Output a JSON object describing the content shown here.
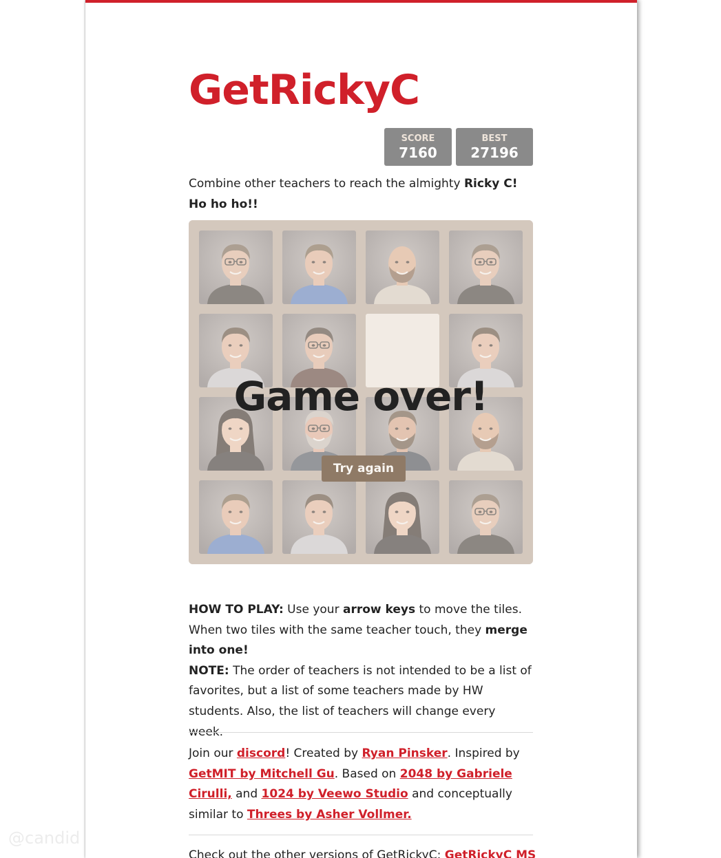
{
  "header": {
    "title": "GetRickyC",
    "score_label": "SCORE",
    "score_value": "7160",
    "best_label": "BEST",
    "best_value": "27196"
  },
  "intro": {
    "text_before": "Combine other teachers to reach the almighty ",
    "highlight": "Ricky C! Ho ho ho!!"
  },
  "board": {
    "rows": [
      [
        "teacher-glasses-man",
        "teacher-blue-shirt-man",
        "teacher-bald-beard-man",
        "teacher-glasses-man"
      ],
      [
        "teacher-plaid-shirt-man",
        "teacher-glasses-woman",
        "empty",
        "teacher-plaid-shirt-man"
      ],
      [
        "teacher-dark-hair-woman",
        "teacher-gray-hair-man",
        "teacher-beard-man",
        "teacher-bald-beard-man"
      ],
      [
        "teacher-blue-shirt-man",
        "teacher-plaid-shirt-man",
        "teacher-dark-hair-woman",
        "teacher-glasses-man"
      ]
    ],
    "game_over_text": "Game over!",
    "try_again_label": "Try again"
  },
  "howto": {
    "label": "HOW TO PLAY:",
    "text1": " Use your ",
    "bold1": "arrow keys",
    "text2": " to move the tiles. When two tiles with the same teacher touch, they ",
    "bold2": "merge into one!",
    "note_label": "NOTE:",
    "note_text": " The order of teachers is not intended to be a list of favorites, but a list of some teachers made by HW students. Also, the list of teachers will change every week."
  },
  "credits": {
    "t1": "Join our ",
    "discord": "discord",
    "t2": "! Created by ",
    "author": "Ryan Pinsker",
    "t3": ". Inspired by ",
    "getmit": "GetMIT by Mitchell Gu",
    "t4": ". Based on ",
    "g2048": "2048 by Gabriele Cirulli,",
    "t5": " and ",
    "g1024": "1024 by Veewo Studio",
    "t6": " and conceptually similar to ",
    "threes": "Threes by Asher Vollmer."
  },
  "versions": {
    "text": "Check out the other versions of GetRickyC: ",
    "link": "GetRickyC MS"
  },
  "watermark": "@candid"
}
